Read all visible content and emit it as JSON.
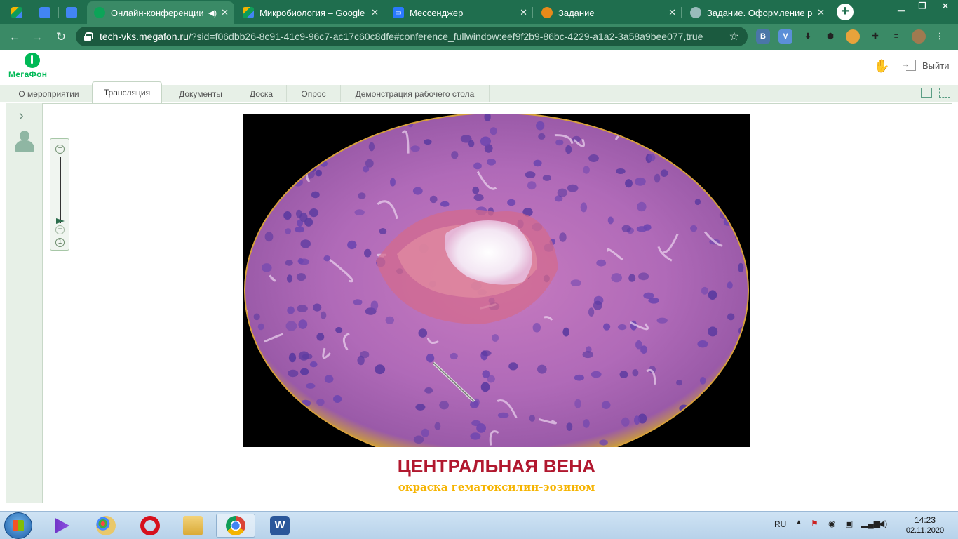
{
  "browser": {
    "tabs": [
      {
        "label": "",
        "favicon": "google-drive-icon"
      },
      {
        "label": "",
        "favicon": "google-docs-icon"
      },
      {
        "label": "",
        "favicon": "google-docs-icon"
      },
      {
        "label": "Онлайн-конференции",
        "favicon": "megafon-icon",
        "audio": "speaker-icon",
        "active": true
      },
      {
        "label": "Микробиология – Google Д",
        "favicon": "google-drive-icon"
      },
      {
        "label": "Мессенджер",
        "favicon": "messenger-icon"
      },
      {
        "label": "Задание",
        "favicon": "task-icon"
      },
      {
        "label": "Задание. Оформление реф",
        "favicon": "globe-icon"
      }
    ],
    "new_tab": "+",
    "url": {
      "host": "tech-vks.megafon.ru",
      "rest": "/?sid=f06dbb26-8c91-41c9-96c7-ac17c60c8dfe#conference_fullwindow:eef9f2b9-86bc-4229-a1a2-3a58a9bee077,true"
    },
    "extensions": [
      "В",
      "V"
    ]
  },
  "app": {
    "logo_text": "МегаФон",
    "exit_label": "Выйти",
    "tabs": [
      {
        "label": "О мероприятии"
      },
      {
        "label": "Трансляция",
        "selected": true
      },
      {
        "label": "Документы"
      },
      {
        "label": "Доска"
      },
      {
        "label": "Опрос"
      },
      {
        "label": "Демонстрация рабочего стола"
      }
    ]
  },
  "zoom": {
    "plus": "+",
    "minus": "−",
    "reset": "1",
    "level_fraction": 0.0
  },
  "slide": {
    "title": "ЦЕНТРАЛЬНАЯ ВЕНА",
    "subtitle": "окраска гематоксилин-эозином"
  },
  "taskbar": {
    "apps": [
      "media-player-icon",
      "paint-icon",
      "opera-icon",
      "file-explorer-icon",
      "chrome-icon",
      "word-icon"
    ],
    "active_app": "chrome-icon",
    "language": "RU",
    "time": "14:23",
    "date": "02.11.2020"
  },
  "colors": {
    "tab_bar": "#1f6e4e",
    "address_bar": "#3a8a66",
    "brand_green": "#00b956",
    "caption_title": "#b1182f",
    "caption_subtitle": "#f6b400"
  }
}
